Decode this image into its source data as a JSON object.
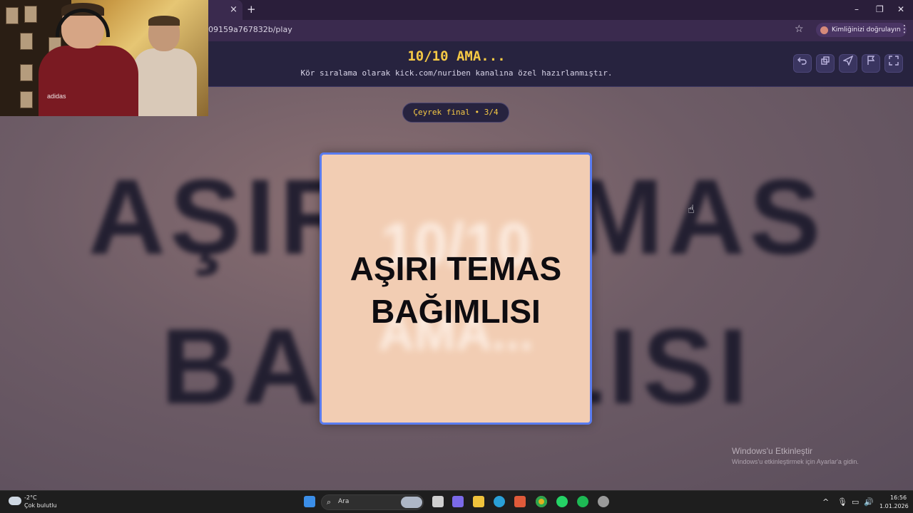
{
  "browser": {
    "tab_close": "×",
    "new_tab": "+",
    "url": "09159a767832b/play",
    "identity_label": "Kimliğinizi doğrulayın",
    "window_controls": [
      "–",
      "❐",
      "✕"
    ]
  },
  "header": {
    "title": "10/10 AMA...",
    "subtitle": "Kör sıralama olarak kick.com/nuriben kanalına özel hazırlanmıştır.",
    "buttons": [
      "undo-icon",
      "copy-icon",
      "send-icon",
      "flag-icon",
      "fullscreen-icon"
    ]
  },
  "round": {
    "label": "Çeyrek final • 3/4"
  },
  "card": {
    "line1": "AŞIRI TEMAS",
    "line2": "BAĞIMLISI",
    "ghost1": "10/10",
    "ghost2": "AMA..."
  },
  "background_text": {
    "line1": "AŞIRI TEMAS",
    "line2": "BAĞIMLISI"
  },
  "watermark": {
    "title": "Windows'u Etkinleştir",
    "subtitle": "Windows'u etkinleştirmek için Ayarlar'a gidin."
  },
  "webcam": {
    "shirt_logo": "adidas"
  },
  "taskbar": {
    "weather_temp": "-2°C",
    "weather_desc": "Çok bulutlu",
    "search_label": "Ara",
    "clock_time": "16:56",
    "clock_date": "1.01.2026"
  },
  "colors": {
    "accent_yellow": "#f6c945",
    "header_bg": "#27233f",
    "card_border": "#5a7cf0",
    "card_bg": "#f2cdb3"
  }
}
